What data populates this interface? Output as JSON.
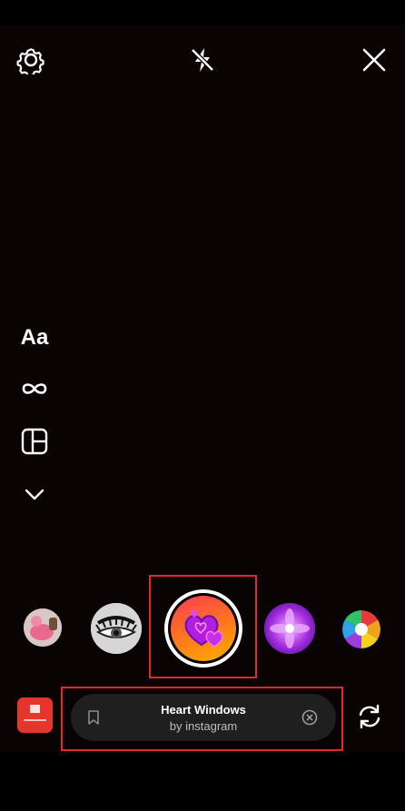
{
  "camera": {
    "top_icons": [
      "gear-icon",
      "flash-off-icon",
      "close-icon"
    ],
    "side_tools": {
      "text_label": "Aa",
      "icons": [
        "boomerang-icon",
        "layout-icon",
        "chevron-down-icon"
      ]
    },
    "effects": [
      {
        "name": "pink-flamingo-effect",
        "selected": false
      },
      {
        "name": "eye-lashes-effect",
        "selected": false
      },
      {
        "name": "heart-windows-effect",
        "selected": true
      },
      {
        "name": "purple-flower-effect",
        "selected": false
      },
      {
        "name": "color-wheel-effect",
        "selected": false
      }
    ],
    "selected_effect": {
      "title": "Heart Windows",
      "author": "by instagram"
    },
    "colors": {
      "highlight": "#e3262f",
      "bar_bg": "#1f1f1f",
      "gallery_thumb": "#e5352d"
    }
  }
}
